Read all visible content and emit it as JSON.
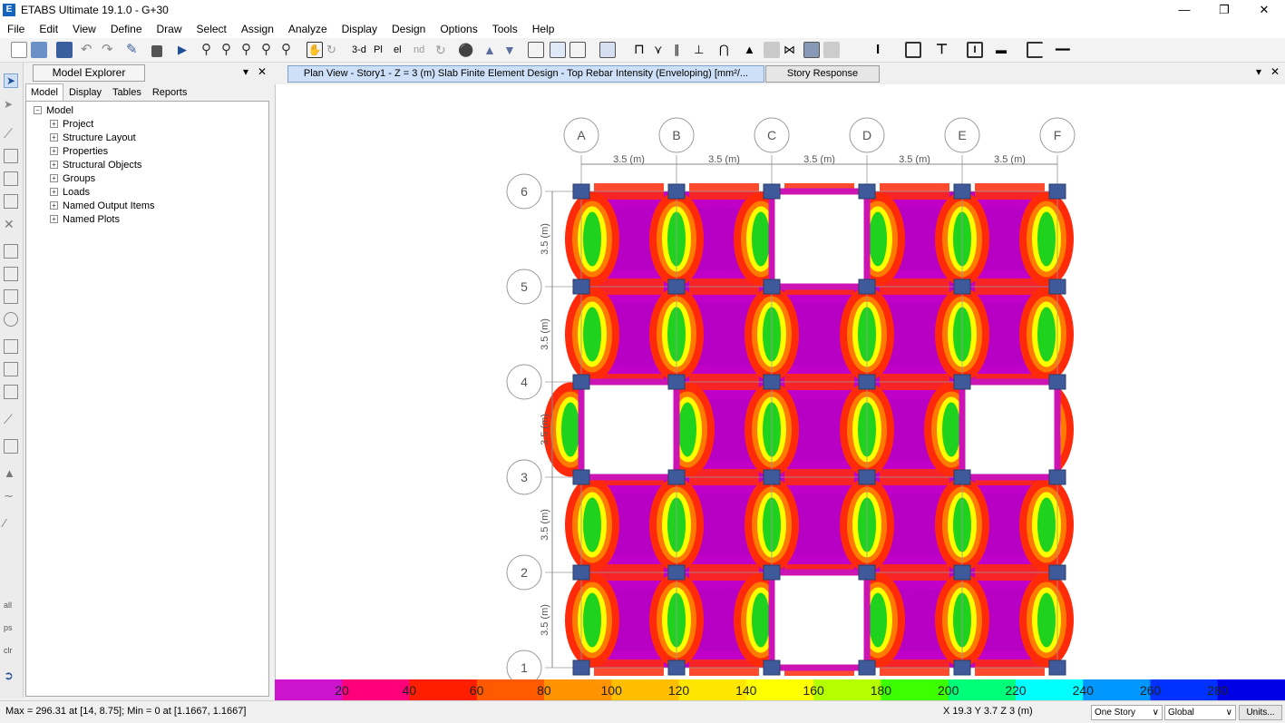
{
  "window": {
    "title": "ETABS Ultimate 19.1.0 - G+30",
    "icon_letter": "E",
    "minimize_icon": "minimize-icon",
    "maximize_icon": "restore-icon",
    "close_icon": "close-icon"
  },
  "menu": [
    "File",
    "Edit",
    "View",
    "Define",
    "Draw",
    "Select",
    "Assign",
    "Analyze",
    "Display",
    "Design",
    "Options",
    "Tools",
    "Help"
  ],
  "toolbar": {
    "view_3d_label": "3-d",
    "plan_label": "Pl",
    "elev_label": "el",
    "nd_label": "nd"
  },
  "explorer": {
    "title": "Model Explorer",
    "pin_icon": "pin-icon",
    "close_icon": "close-icon",
    "tabs": [
      "Model",
      "Display",
      "Tables",
      "Reports"
    ],
    "active_tab": "Model",
    "tree_root": "Model",
    "tree_items": [
      "Project",
      "Structure Layout",
      "Properties",
      "Structural Objects",
      "Groups",
      "Loads",
      "Named Output Items",
      "Named Plots"
    ]
  },
  "doc_tabs": {
    "active": "Plan View - Story1 - Z = 3 (m)  Slab Finite Element Design - Top Rebar Intensity (Enveloping) [mm²/...",
    "second": "Story Response"
  },
  "plan": {
    "grid_x": [
      "A",
      "B",
      "C",
      "D",
      "E",
      "F"
    ],
    "grid_y": [
      "6",
      "5",
      "4",
      "3",
      "2",
      "1"
    ],
    "spacing_label": "3.5 (m)",
    "openings": [
      {
        "between_x": [
          "C",
          "D"
        ],
        "between_y": [
          "6",
          "5"
        ]
      },
      {
        "between_x": [
          "A",
          "B"
        ],
        "between_y": [
          "4",
          "3"
        ]
      },
      {
        "between_x": [
          "E",
          "F"
        ],
        "between_y": [
          "4",
          "3"
        ]
      },
      {
        "between_x": [
          "C",
          "D"
        ],
        "between_y": [
          "2",
          "1"
        ]
      }
    ]
  },
  "colors": {
    "magenta": "#c000c8",
    "red": "#ff2a0a",
    "orange": "#ff7a00",
    "yellow": "#ffff00",
    "green": "#1ed21e",
    "column": "#3e5a9a",
    "beam": "#cc14b4"
  },
  "legend": {
    "ticks": [
      "20",
      "40",
      "60",
      "80",
      "100",
      "120",
      "140",
      "160",
      "180",
      "200",
      "220",
      "240",
      "260",
      "280"
    ],
    "colors": [
      "#cc14cc",
      "#ff007a",
      "#ff1e00",
      "#ff5a00",
      "#ff9400",
      "#ffbe00",
      "#ffe600",
      "#ffff00",
      "#b4ff00",
      "#3cff00",
      "#00ff78",
      "#00ffff",
      "#0096ff",
      "#0032ff",
      "#0000e6"
    ]
  },
  "status": {
    "left": "Max = 296.31 at [14, 8.75];  Min = 0 at [1.1667, 1.1667]",
    "coords": "X 19.3  Y 3.7  Z 3 (m)",
    "story_select": "One Story",
    "coord_select": "Global",
    "units_button": "Units..."
  }
}
